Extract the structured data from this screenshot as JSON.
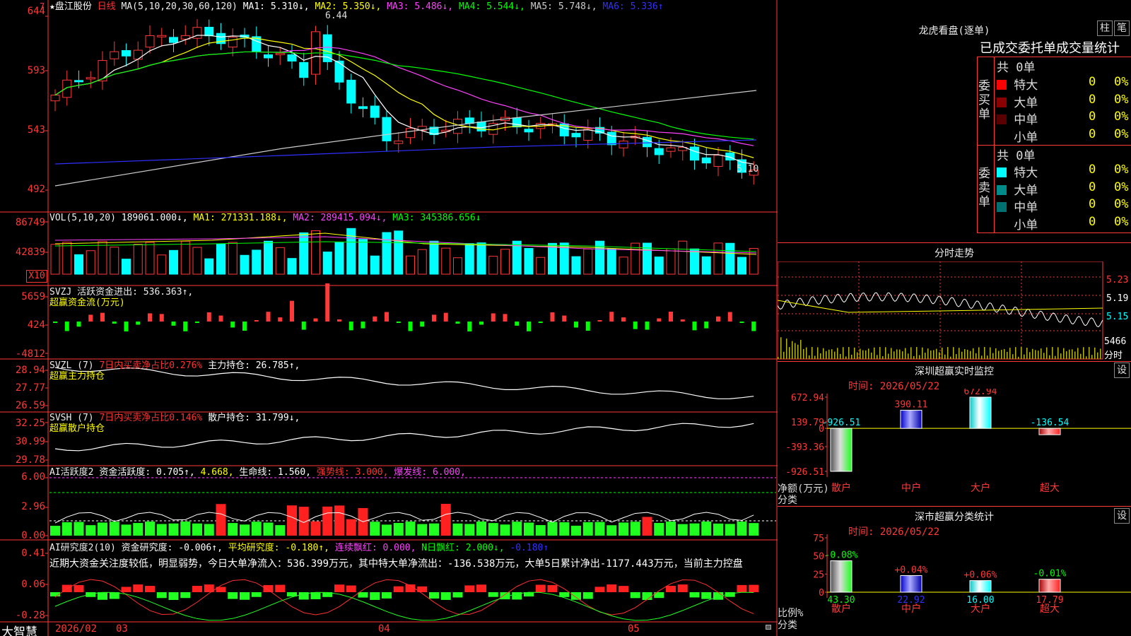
{
  "left_axis_marker": "7",
  "stock_header": {
    "name": "★盘江股份",
    "period": "日线",
    "ma_params": "MA(5,10,20,30,60,120)",
    "ma1": "MA1: 5.310↓,",
    "ma2": "MA2: 5.350↓,",
    "ma3": "MA3: 5.486↓,",
    "ma4": "MA4: 5.544↓,",
    "ma5": "MA5: 5.748↓,",
    "ma6": "MA6: 5.336↑"
  },
  "price_panel": {
    "y_ticks": [
      "644",
      "593",
      "543",
      "492"
    ],
    "high_label": "6.44",
    "last_label": "5.10"
  },
  "vol_panel": {
    "params": "VOL(5,10,20)",
    "vol": "189061.000↓,",
    "ma1": "MA1: 271331.188↓,",
    "ma2": "MA2: 289415.094↓,",
    "ma3": "MA3: 345386.656↓",
    "y_ticks": [
      "86749",
      "42839"
    ],
    "unit": "X10"
  },
  "svzj_panel": {
    "line1": "SVZJ  活跃资金进出: 536.363↑,",
    "line2": "超赢资金流(万元)",
    "y_ticks": [
      "5659",
      "424",
      "-4812"
    ]
  },
  "svzl_panel": {
    "prefix": "SVZL (7)",
    "ratio": "7日内买卖净占比0.276%",
    "hold": "主力持仓: 26.785↑,",
    "line2": "超赢主力持仓",
    "y_ticks": [
      "28.94",
      "27.77",
      "26.59"
    ]
  },
  "svsh_panel": {
    "prefix": "SVSH (7)",
    "ratio": "7日内买卖净占比0.146%",
    "hold": "散户持仓: 31.799↓,",
    "line2": "超赢散户持仓",
    "y_ticks": [
      "32.25",
      "30.99",
      "29.78"
    ]
  },
  "ai_active_panel": {
    "name": "AI活跃度2",
    "activity": "资金活跃度: 0.705↑,",
    "v2": "4.668,",
    "life": "生命线: 1.560,",
    "strong": "强势线: 3.000,",
    "burst": "爆发线: 6.000,",
    "y_ticks": [
      "6.00",
      "2.96",
      "0.00"
    ]
  },
  "ai_research_panel": {
    "name": "AI研究度2(10)",
    "research": "资金研究度: -0.006↑,",
    "avg": "平均研究度: -0.180↑,",
    "streak": "连续飘红: 0.000,",
    "nred": "N日飘红: 2.000↓,",
    "last": "-0.180↑",
    "commentary": "近期大资金关注度较低，明显弱势，今日大单净流入：536.399万元，其中特大单净流出：-136.538万元，大单5日累计净出-1177.443万元，当前主力控盘",
    "y_ticks": [
      "0.41",
      "0.06",
      "-0.28"
    ]
  },
  "bottom_bar": {
    "brand": "大智慧",
    "dates": [
      "2026/02",
      "03",
      "04",
      "05"
    ]
  },
  "dragon_tiger": {
    "title": "龙虎看盘(逐单)",
    "btn1": "柱",
    "btn2": "笔",
    "subtitle": "已成交委托单成交量统计",
    "buy_label": "委买单",
    "sell_label": "委卖单",
    "buy_total": "共 0单",
    "sell_total": "共 0单",
    "buy_rows": [
      {
        "label": "特大",
        "count": "0",
        "pct": "0%",
        "color": "#ff0000"
      },
      {
        "label": "大单",
        "count": "0",
        "pct": "0%",
        "color": "#8b0000"
      },
      {
        "label": "中单",
        "count": "0",
        "pct": "0%",
        "color": "#5a0000"
      },
      {
        "label": "小单",
        "count": "0",
        "pct": "0%",
        "color": ""
      }
    ],
    "sell_rows": [
      {
        "label": "特大",
        "count": "0",
        "pct": "0%",
        "color": "#00ffff"
      },
      {
        "label": "大单",
        "count": "0",
        "pct": "0%",
        "color": "#008b8b"
      },
      {
        "label": "中单",
        "count": "0",
        "pct": "0%",
        "color": "#007070"
      },
      {
        "label": "小单",
        "count": "0",
        "pct": "0%",
        "color": ""
      }
    ]
  },
  "intraday": {
    "title": "分时走势",
    "price_ticks": [
      "5.23",
      "5.19",
      "5.15"
    ],
    "vol_tick": "5466",
    "vol_unit": "分时"
  },
  "sz_monitor": {
    "title": "深圳超赢实时监控",
    "settings": "设",
    "time": "时间: 2026/05/22",
    "y_ticks": [
      "672.94",
      "139.79",
      "0",
      "-393.36",
      "-926.51"
    ],
    "y_unit_1": "净额(万元)",
    "y_unit_2": "分类",
    "categories": [
      "散户",
      "中户",
      "大户",
      "超大"
    ],
    "values": [
      -926.51,
      390.11,
      672.94,
      -136.54
    ],
    "value_labels": [
      "-926.51",
      "390.11",
      "672.94",
      "-136.54"
    ]
  },
  "sz_category": {
    "title": "深市超赢分类统计",
    "settings": "设",
    "time": "时间: 2026/05/22",
    "y_ticks": [
      "75",
      "50",
      "25",
      "0"
    ],
    "y_unit_1": "比例%",
    "y_unit_2": "分类",
    "categories": [
      "散户",
      "中户",
      "大户",
      "超大"
    ],
    "values": [
      43.3,
      22.92,
      16.0,
      17.79
    ],
    "value_labels": [
      "43.30",
      "22.92",
      "16.00",
      "17.79"
    ],
    "change_labels": [
      "-0.08%",
      "+0.04%",
      "+0.06%",
      "-0.01%"
    ]
  },
  "chart_data": [
    {
      "type": "candlestick",
      "title": "盘江股份 日线",
      "x": [
        "2026/02",
        "03",
        "04",
        "05"
      ],
      "ylim": [
        4.92,
        6.44
      ],
      "high": 6.44,
      "last": 5.1,
      "moving_averages": {
        "MA1": 5.31,
        "MA2": 5.35,
        "MA3": 5.486,
        "MA4": 5.544,
        "MA5": 5.748,
        "MA6": 5.336
      }
    },
    {
      "type": "bar",
      "title": "深圳超赢实时监控",
      "categories": [
        "散户",
        "中户",
        "大户",
        "超大"
      ],
      "values": [
        -926.51,
        390.11,
        672.94,
        -136.54
      ],
      "ylabel": "净额(万元)",
      "ylim": [
        -926.51,
        672.94
      ]
    },
    {
      "type": "bar",
      "title": "深市超赢分类统计",
      "categories": [
        "散户",
        "中户",
        "大户",
        "超大"
      ],
      "values": [
        43.3,
        22.92,
        16.0,
        17.79
      ],
      "ylabel": "比例%",
      "ylim": [
        0,
        75
      ]
    }
  ]
}
